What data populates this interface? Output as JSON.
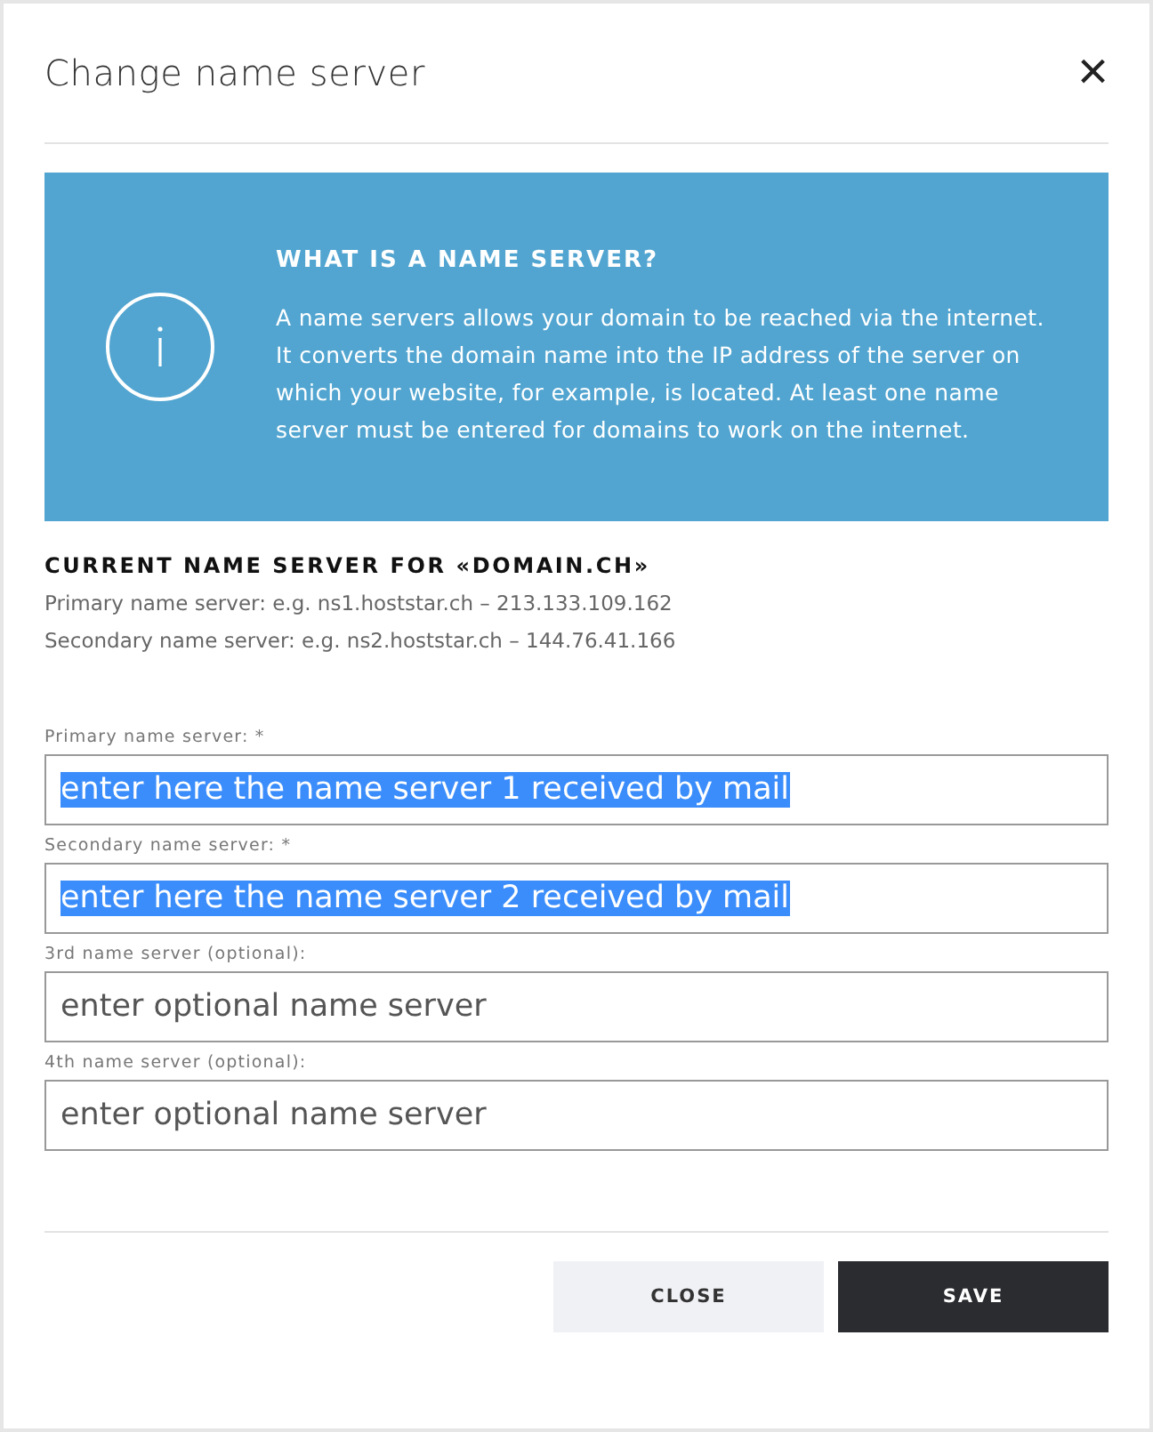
{
  "dialog": {
    "title": "Change name server",
    "close_icon": "×"
  },
  "info": {
    "heading": "WHAT IS A NAME SERVER?",
    "text": "A name servers allows your domain to be reached via the internet. It converts the domain name into the IP address of the server on which your website, for example, is located. At least one name server must be entered for domains to work on the internet."
  },
  "current": {
    "heading": "CURRENT NAME SERVER FOR «DOMAIN.CH»",
    "lines": [
      "Primary name server: e.g. ns1.hoststar.ch – 213.133.109.162",
      "Secondary name server: e.g. ns2.hoststar.ch – 144.76.41.166"
    ]
  },
  "fields": [
    {
      "label": "Primary name server: *",
      "value": "enter here the name server 1 received by mail",
      "selected": true
    },
    {
      "label": "Secondary name server: *",
      "value": "enter here the name server 2 received by mail",
      "selected": true
    },
    {
      "label": "3rd name server (optional):",
      "placeholder": "enter optional name server",
      "selected": false
    },
    {
      "label": "4th name server (optional):",
      "placeholder": "enter optional name server",
      "selected": false
    }
  ],
  "buttons": [
    {
      "label": "CLOSE",
      "kind": "secondary"
    },
    {
      "label": "SAVE",
      "kind": "primary"
    }
  ]
}
